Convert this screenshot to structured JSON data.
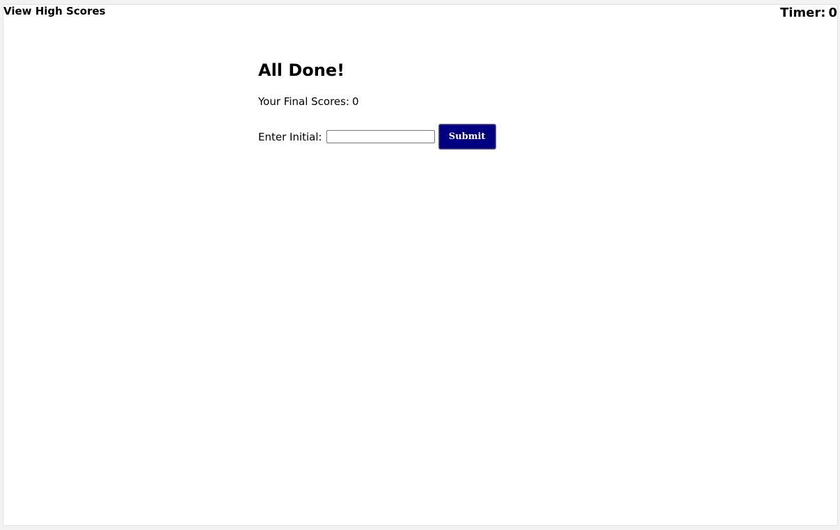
{
  "header": {
    "high_scores_link": "View High Scores",
    "timer_label": "Timer:",
    "timer_value": "0"
  },
  "main": {
    "title": "All Done!",
    "final_score_label": "Your Final Scores:",
    "final_score_value": "0",
    "initials_label": "Enter Initial:",
    "initials_value": "",
    "initials_placeholder": "",
    "submit_label": "Submit"
  },
  "colors": {
    "submit_background": "#000080",
    "submit_text": "#ffffff",
    "page_background": "#ffffff"
  }
}
